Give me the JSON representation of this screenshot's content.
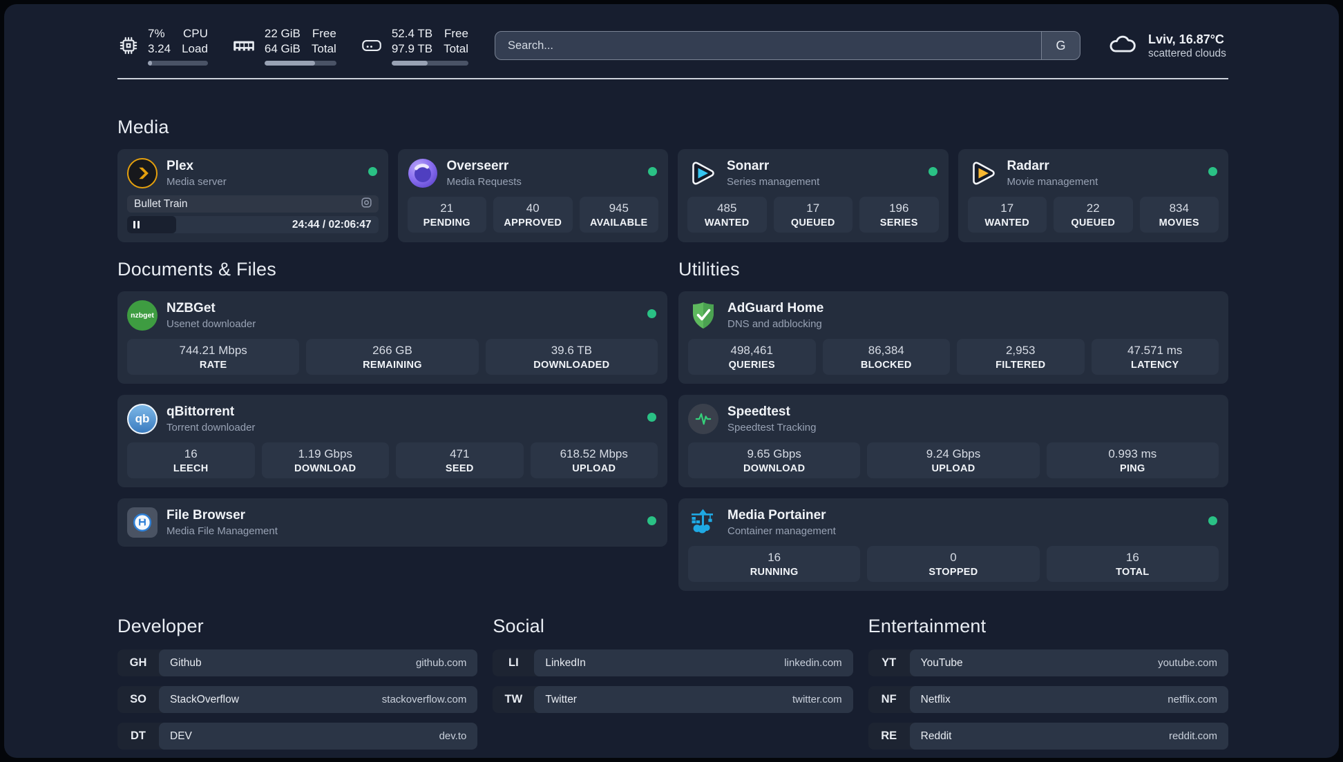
{
  "colors": {
    "status_ok": "#2ac185",
    "accent_plex": "#e5a00d",
    "background": "#171e2f"
  },
  "topbar": {
    "cpu": {
      "value1": "7%",
      "value2": "3.24",
      "label1": "CPU",
      "label2": "Load",
      "progress_pct": 7
    },
    "ram": {
      "value1": "22 GiB",
      "value2": "64 GiB",
      "label1": "Free",
      "label2": "Total",
      "progress_pct": 70
    },
    "disk": {
      "value1": "52.4 TB",
      "value2": "97.9 TB",
      "label1": "Free",
      "label2": "Total",
      "progress_pct": 47
    },
    "search": {
      "placeholder": "Search...",
      "engine": "G"
    },
    "weather": {
      "title": "Lviv, 16.87°C",
      "subtitle": "scattered clouds"
    }
  },
  "media": {
    "title": "Media",
    "plex": {
      "name": "Plex",
      "desc": "Media server",
      "now_playing": "Bullet Train",
      "time": "24:44 / 02:06:47",
      "progress_pct": 19.5
    },
    "overseerr": {
      "name": "Overseerr",
      "desc": "Media Requests",
      "stats": [
        {
          "value": "21",
          "label": "PENDING"
        },
        {
          "value": "40",
          "label": "APPROVED"
        },
        {
          "value": "945",
          "label": "AVAILABLE"
        }
      ]
    },
    "sonarr": {
      "name": "Sonarr",
      "desc": "Series management",
      "stats": [
        {
          "value": "485",
          "label": "WANTED"
        },
        {
          "value": "17",
          "label": "QUEUED"
        },
        {
          "value": "196",
          "label": "SERIES"
        }
      ]
    },
    "radarr": {
      "name": "Radarr",
      "desc": "Movie management",
      "stats": [
        {
          "value": "17",
          "label": "WANTED"
        },
        {
          "value": "22",
          "label": "QUEUED"
        },
        {
          "value": "834",
          "label": "MOVIES"
        }
      ]
    }
  },
  "documents": {
    "title": "Documents & Files",
    "nzbget": {
      "name": "NZBGet",
      "desc": "Usenet downloader",
      "logo_text": "nzbget",
      "stats": [
        {
          "value": "744.21 Mbps",
          "label": "RATE"
        },
        {
          "value": "266 GB",
          "label": "REMAINING"
        },
        {
          "value": "39.6 TB",
          "label": "DOWNLOADED"
        }
      ]
    },
    "qbittorrent": {
      "name": "qBittorrent",
      "desc": "Torrent downloader",
      "logo_text": "qb",
      "stats": [
        {
          "value": "16",
          "label": "LEECH"
        },
        {
          "value": "1.19 Gbps",
          "label": "DOWNLOAD"
        },
        {
          "value": "471",
          "label": "SEED"
        },
        {
          "value": "618.52 Mbps",
          "label": "UPLOAD"
        }
      ]
    },
    "filebrowser": {
      "name": "File Browser",
      "desc": "Media File Management"
    }
  },
  "utilities": {
    "title": "Utilities",
    "adguard": {
      "name": "AdGuard Home",
      "desc": "DNS and adblocking",
      "stats": [
        {
          "value": "498,461",
          "label": "QUERIES"
        },
        {
          "value": "86,384",
          "label": "BLOCKED"
        },
        {
          "value": "2,953",
          "label": "FILTERED"
        },
        {
          "value": "47.571 ms",
          "label": "LATENCY"
        }
      ]
    },
    "speedtest": {
      "name": "Speedtest",
      "desc": "Speedtest Tracking",
      "stats": [
        {
          "value": "9.65 Gbps",
          "label": "DOWNLOAD"
        },
        {
          "value": "9.24 Gbps",
          "label": "UPLOAD"
        },
        {
          "value": "0.993 ms",
          "label": "PING"
        }
      ]
    },
    "portainer": {
      "name": "Media Portainer",
      "desc": "Container management",
      "stats": [
        {
          "value": "16",
          "label": "RUNNING"
        },
        {
          "value": "0",
          "label": "STOPPED"
        },
        {
          "value": "16",
          "label": "TOTAL"
        }
      ]
    }
  },
  "bookmarks": [
    {
      "title": "Developer",
      "links": [
        {
          "abbr": "GH",
          "name": "Github",
          "url": "github.com"
        },
        {
          "abbr": "SO",
          "name": "StackOverflow",
          "url": "stackoverflow.com"
        },
        {
          "abbr": "DT",
          "name": "DEV",
          "url": "dev.to"
        }
      ]
    },
    {
      "title": "Social",
      "links": [
        {
          "abbr": "LI",
          "name": "LinkedIn",
          "url": "linkedin.com"
        },
        {
          "abbr": "TW",
          "name": "Twitter",
          "url": "twitter.com"
        }
      ]
    },
    {
      "title": "Entertainment",
      "links": [
        {
          "abbr": "YT",
          "name": "YouTube",
          "url": "youtube.com"
        },
        {
          "abbr": "NF",
          "name": "Netflix",
          "url": "netflix.com"
        },
        {
          "abbr": "RE",
          "name": "Reddit",
          "url": "reddit.com"
        }
      ]
    }
  ]
}
